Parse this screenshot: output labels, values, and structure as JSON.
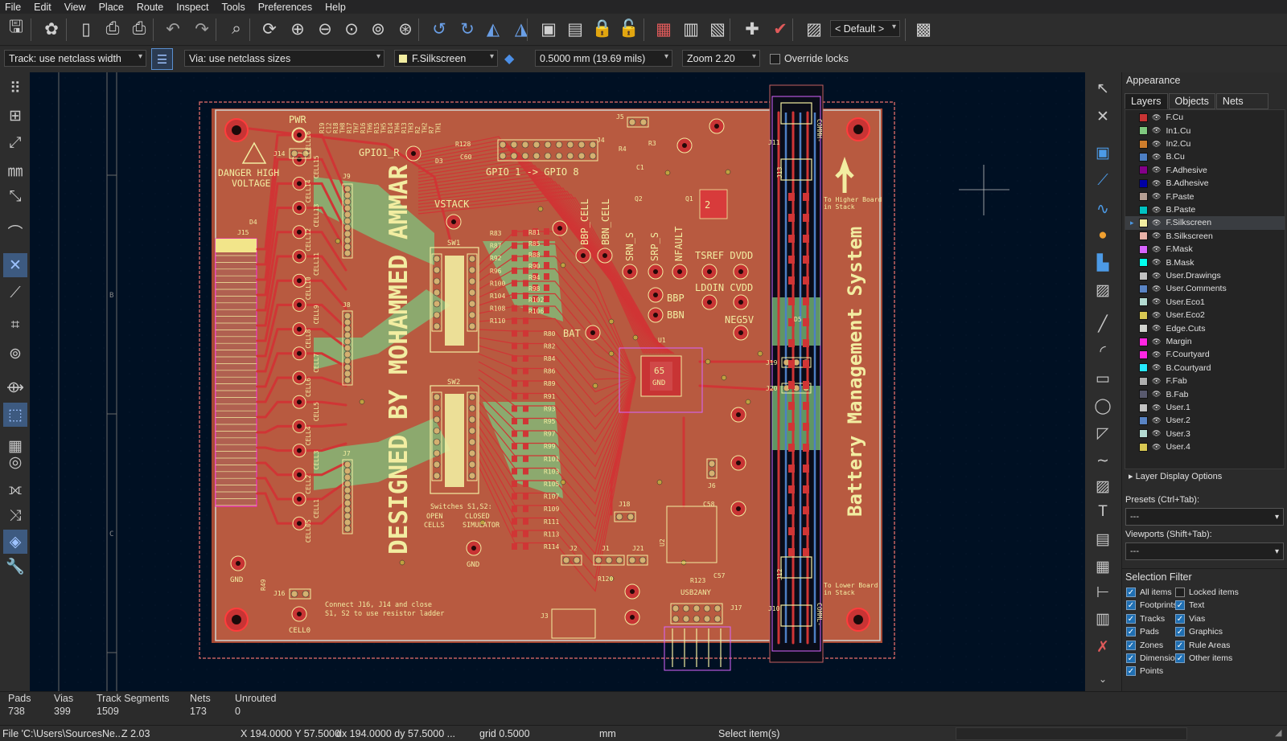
{
  "menu": [
    "File",
    "Edit",
    "View",
    "Place",
    "Route",
    "Inspect",
    "Tools",
    "Preferences",
    "Help"
  ],
  "toolbar": {
    "icons": [
      "save-icon",
      "plugin-icon",
      "new-board-icon",
      "print-icon",
      "plot-icon",
      "undo-icon",
      "redo-icon",
      "find-icon",
      "refresh-icon",
      "zoom-in-icon",
      "zoom-out-icon",
      "zoom-fit-icon",
      "zoom-objects-icon",
      "zoom-selection-icon",
      "rotate-ccw-icon",
      "rotate-cw-icon",
      "flip-icon",
      "mirror-icon",
      "group-icon",
      "ungroup-icon",
      "lock-icon",
      "unlock-icon",
      "board-setup-icon",
      "footprint-editor-icon",
      "footprint-browser-icon",
      "update-pcb-icon",
      "drc-icon",
      "scripting-icon",
      "layer-preset-icon"
    ],
    "layer_preset": "< Default >"
  },
  "options": {
    "track": "Track: use netclass width",
    "via": "Via: use netclass sizes",
    "layer": "F.Silkscreen",
    "layer_color": "#f2eda1",
    "grid": "0.5000 mm (19.69 mils)",
    "zoom": "Zoom 2.20",
    "override_locks": "Override locks"
  },
  "left_tools": [
    "grid-toggle-icon",
    "grid-polar-icon",
    "ratsnest-icon",
    "units-mm-icon",
    "cursor-fullscreen-icon",
    "graph-icon",
    "ratsnest-toggle-icon",
    "curved-ratsnest-icon",
    "show-pads-icon",
    "show-vias-icon",
    "highlight-net-icon",
    "zone-outline-icon",
    "zone-fill-icon",
    "teardrop-icon",
    "net-inspector-icon",
    "diff-pair-icon",
    "layer-manager-icon",
    "properties-icon"
  ],
  "right_tools": [
    "select-arrow-icon",
    "local-ratsnest-icon",
    "place-footprint-icon",
    "route-track-icon",
    "tune-length-icon",
    "add-via-icon",
    "add-zone-icon",
    "rule-area-icon",
    "draw-line-icon",
    "draw-arc-icon",
    "draw-rectangle-icon",
    "draw-circle-icon",
    "draw-polygon-icon",
    "bezier-icon",
    "place-image-icon",
    "add-text-icon",
    "add-textbox-icon",
    "add-table-icon",
    "dimension-icon",
    "barcode-icon",
    "delete-tool-icon",
    "more-chevron-icon"
  ],
  "appearance": {
    "title": "Appearance",
    "tabs": [
      "Layers",
      "Objects",
      "Nets"
    ],
    "layers": [
      {
        "name": "F.Cu",
        "color": "#c83434"
      },
      {
        "name": "In1.Cu",
        "color": "#7fc87f"
      },
      {
        "name": "In2.Cu",
        "color": "#ce7d2c"
      },
      {
        "name": "B.Cu",
        "color": "#4d7fc4"
      },
      {
        "name": "F.Adhesive",
        "color": "#84008a"
      },
      {
        "name": "B.Adhesive",
        "color": "#0000a4"
      },
      {
        "name": "F.Paste",
        "color": "#b49e93"
      },
      {
        "name": "B.Paste",
        "color": "#00c2c2"
      },
      {
        "name": "F.Silkscreen",
        "color": "#f2eda1"
      },
      {
        "name": "B.Silkscreen",
        "color": "#e8b2a7"
      },
      {
        "name": "F.Mask",
        "color": "#d864ff"
      },
      {
        "name": "B.Mask",
        "color": "#02ffee"
      },
      {
        "name": "User.Drawings",
        "color": "#c2c2c2"
      },
      {
        "name": "User.Comments",
        "color": "#5984c4"
      },
      {
        "name": "User.Eco1",
        "color": "#b4dbd2"
      },
      {
        "name": "User.Eco2",
        "color": "#d8c852"
      },
      {
        "name": "Edge.Cuts",
        "color": "#d0d2cd"
      },
      {
        "name": "Margin",
        "color": "#ff26e2"
      },
      {
        "name": "F.Courtyard",
        "color": "#ff26e2"
      },
      {
        "name": "B.Courtyard",
        "color": "#26e9ff"
      },
      {
        "name": "F.Fab",
        "color": "#afafaf"
      },
      {
        "name": "B.Fab",
        "color": "#58596e"
      },
      {
        "name": "User.1",
        "color": "#c2c2c2"
      },
      {
        "name": "User.2",
        "color": "#5984c4"
      },
      {
        "name": "User.3",
        "color": "#b4dbd2"
      },
      {
        "name": "User.4",
        "color": "#d8c852"
      }
    ],
    "selected_layer": "F.Silkscreen",
    "layer_display_options": "Layer Display Options",
    "presets_label": "Presets (Ctrl+Tab):",
    "presets_value": "---",
    "viewports_label": "Viewports (Shift+Tab):",
    "viewports_value": "---"
  },
  "selection_filter": {
    "title": "Selection Filter",
    "items": [
      {
        "label": "All items",
        "checked": true
      },
      {
        "label": "Locked items",
        "checked": false
      },
      {
        "label": "Footprints",
        "checked": true
      },
      {
        "label": "Text",
        "checked": true
      },
      {
        "label": "Tracks",
        "checked": true
      },
      {
        "label": "Vias",
        "checked": true
      },
      {
        "label": "Pads",
        "checked": true
      },
      {
        "label": "Graphics",
        "checked": true
      },
      {
        "label": "Zones",
        "checked": true
      },
      {
        "label": "Rule Areas",
        "checked": true
      },
      {
        "label": "Dimensions",
        "checked": true
      },
      {
        "label": "Other items",
        "checked": true
      },
      {
        "label": "Points",
        "checked": true
      }
    ]
  },
  "stats": [
    {
      "label": "Pads",
      "value": "738"
    },
    {
      "label": "Vias",
      "value": "399"
    },
    {
      "label": "Track Segments",
      "value": "1509"
    },
    {
      "label": "Nets",
      "value": "173"
    },
    {
      "label": "Unrouted",
      "value": "0"
    }
  ],
  "status": {
    "file": "File 'C:\\Users\\SourcesNe...",
    "z": "Z 2.03",
    "xy": "X 194.0000  Y 57.5000",
    "dxdy": "dx 194.0000  dy 57.5000 ...",
    "grid": "grid 0.5000",
    "units": "mm",
    "message": "Select item(s)"
  },
  "board": {
    "frame_rows": [
      "B",
      "C"
    ],
    "text": {
      "designer": "DESIGNED BY MOHAMMED AMMAR",
      "title": "Battery Management System",
      "danger": "DANGER HIGH",
      "voltage": "VOLTAGE",
      "pwr": "PWR",
      "gpio1r": "GPIO1_R",
      "gpio_range": "GPIO 1  ->  GPIO 8",
      "vstack": "VSTACK",
      "bbp_cell": "BBP_CELL",
      "bbn_cell": "BBN_CELL",
      "srn_s": "SRN_S",
      "srp_s": "SRP_S",
      "nfault": "NFAULT",
      "tsref_dvdd": "TSREF DVDD",
      "ldoin_cvdd": "LDOIN CVDD",
      "bbp": "BBP",
      "bbn": "BBN",
      "bat": "BAT",
      "neg5v": "NEG5V",
      "gnd_left": "GND",
      "gnd_mid": "GND",
      "cell0": "CELL0",
      "sw1": "SW1",
      "sw2": "SW2",
      "switches": "Switches S1,S2:",
      "open": "OPEN",
      "cells": "CELLS",
      "closed": "CLOSED",
      "simulator": "SIMULATOR",
      "connect1": "Connect J16, J14 and close",
      "connect2": "S1, S2 to use resistor ladder",
      "higher1": "To Higher Board",
      "higher2": "in Stack",
      "lower1": "To Lower Board",
      "lower2": "in Stack",
      "usb": "USB2ANY",
      "u1_pad": "65",
      "u1_gnd": "GND",
      "j15": "J15",
      "j14": "J14",
      "j16": "J16",
      "j9": "J9",
      "j8": "J8",
      "j7": "J7",
      "j5": "J5",
      "j4": "J4",
      "j19": "J19",
      "j20": "J20",
      "j11": "J11",
      "j13": "J13",
      "j12": "J12",
      "j10": "J10",
      "j17": "J17",
      "j3": "J3",
      "j2": "J2",
      "j1": "J1",
      "j21": "J21",
      "j18": "J18",
      "j6": "J6",
      "d3": "D3",
      "d4": "D4",
      "d5": "D5",
      "q1": "Q1",
      "q2": "Q2",
      "u1": "U1",
      "u2": "U2",
      "r128": "R128",
      "c60": "C60",
      "r4": "R4",
      "r3": "R3",
      "c1": "C1",
      "r49": "R49",
      "r120": "R120",
      "r123": "R123",
      "c57": "C57",
      "c58": "C58",
      "comml": "COMML-",
      "commh": "COMMH-"
    },
    "cells": [
      "CELL16",
      "CELL15",
      "CELL14",
      "CELL13",
      "CELL12",
      "CELL11",
      "CELL10",
      "CELL9",
      "CELL8",
      "CELL7",
      "CELL6",
      "CELL5",
      "CELL4",
      "CELL3",
      "CELL2",
      "CELL1",
      "CELL0S"
    ],
    "resistors_top": [
      "R19",
      "C12",
      "R18",
      "TH8",
      "R17",
      "TH7",
      "R16",
      "TH6",
      "R15",
      "TH5",
      "R14",
      "TH4",
      "R13",
      "TH3",
      "R2",
      "TH2",
      "R7",
      "TH1"
    ],
    "resistors_mid": [
      "R83",
      "R87",
      "R92",
      "R96",
      "R100",
      "R104",
      "R108",
      "R110",
      "R80",
      "R82",
      "R84",
      "R86",
      "R89",
      "R91",
      "R93",
      "R95",
      "R97",
      "R99",
      "R101",
      "R103",
      "R105",
      "R107",
      "R109",
      "R111",
      "R113",
      "R114"
    ],
    "resistors_small": [
      "R81",
      "R85",
      "R88",
      "R90",
      "R94",
      "R98",
      "R102",
      "R106"
    ]
  }
}
